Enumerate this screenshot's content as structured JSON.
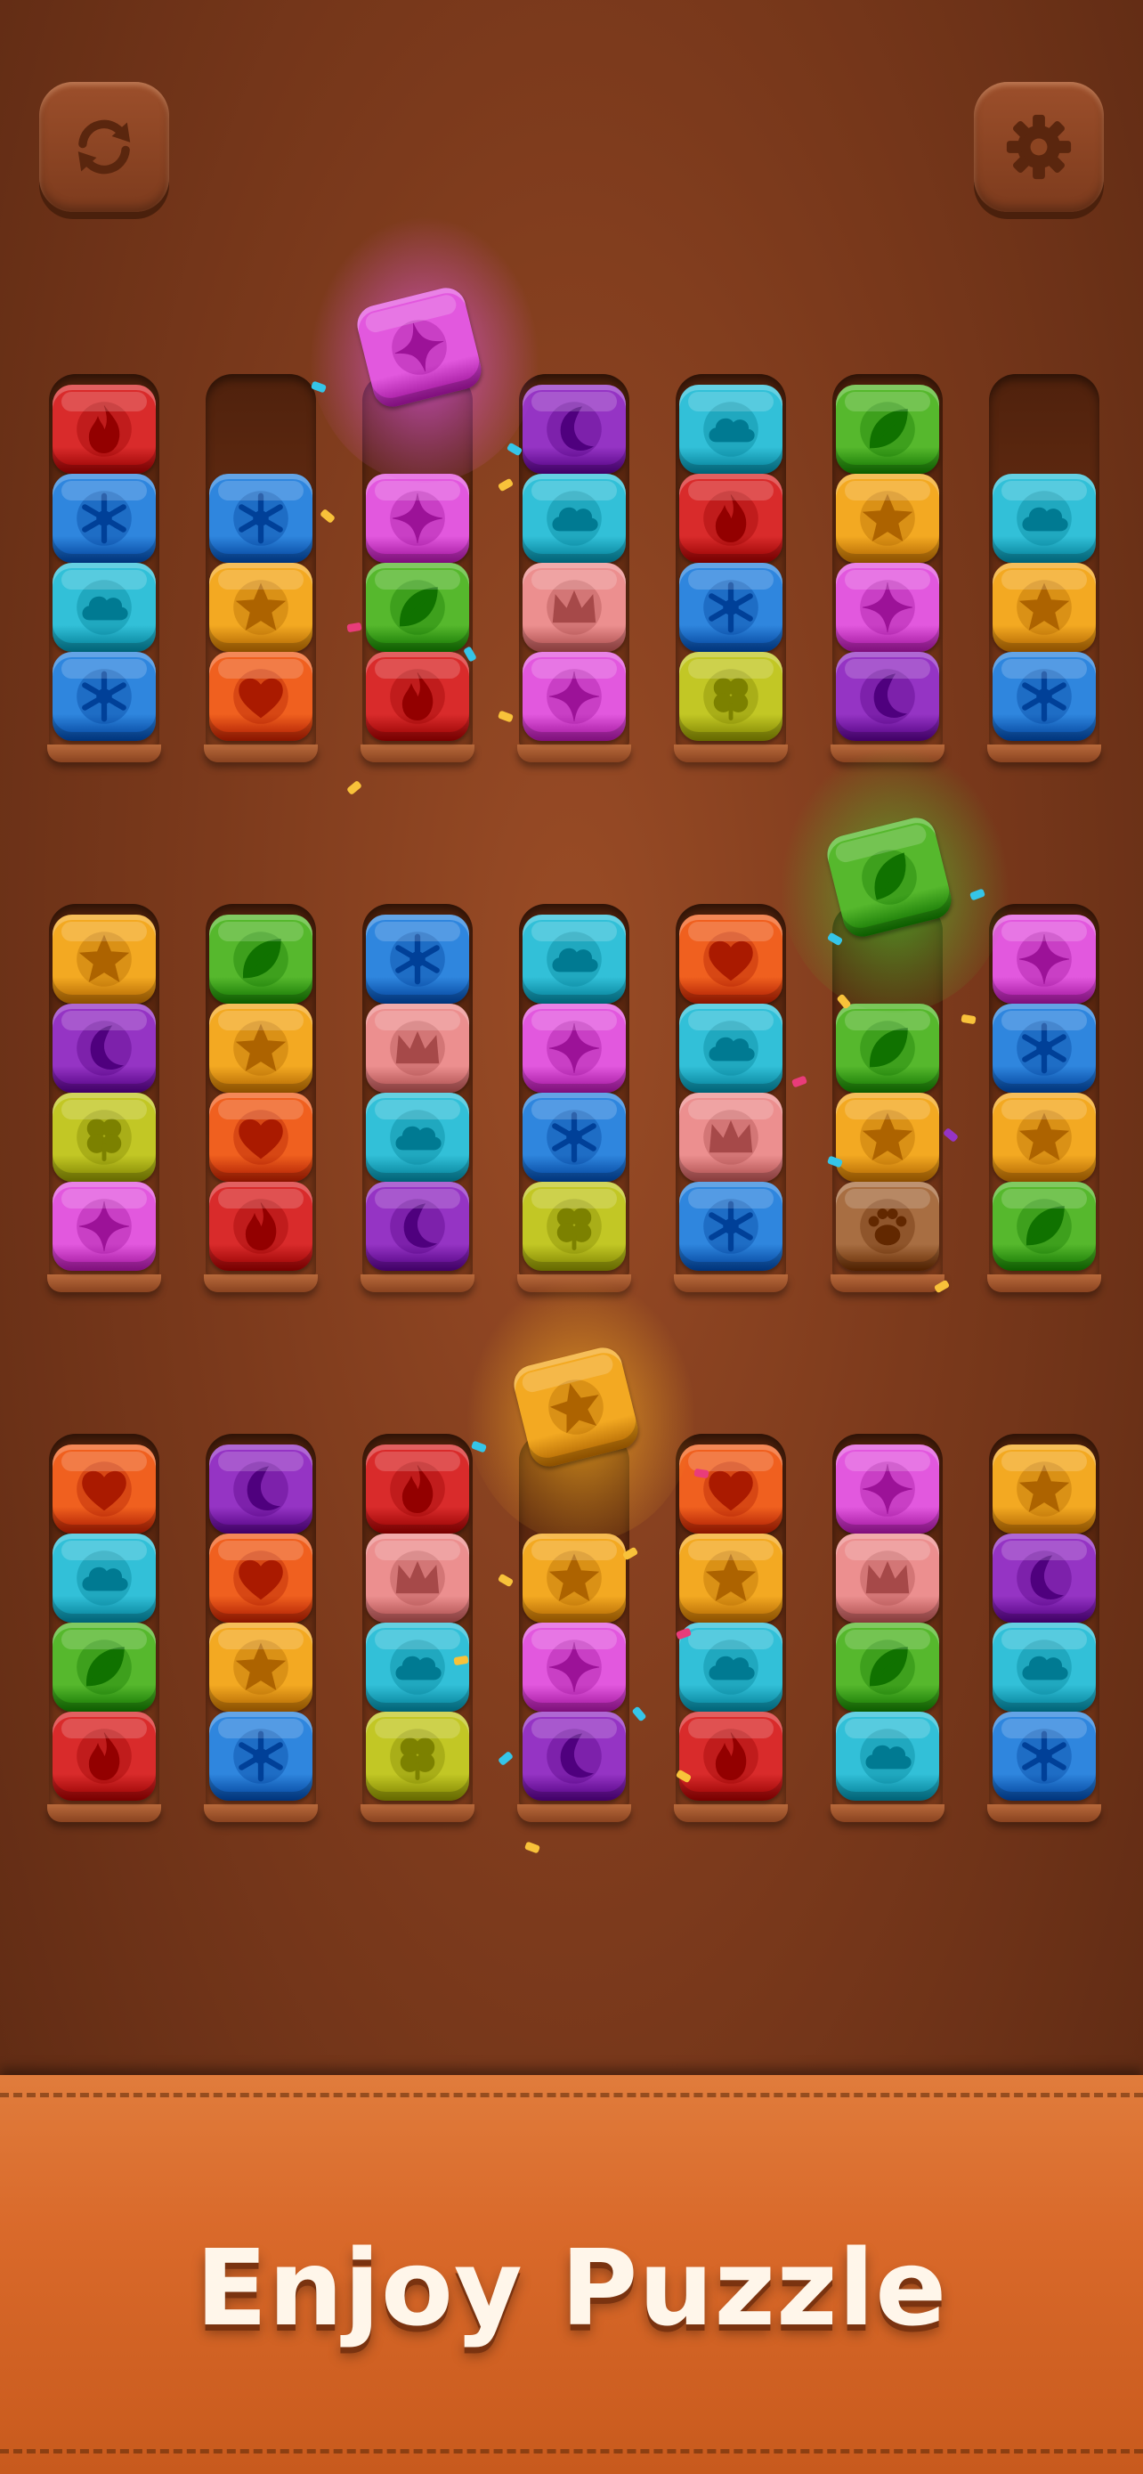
{
  "banner": {
    "title": "Enjoy Puzzle"
  },
  "buttons": {
    "restart_icon": "restart-icon",
    "settings_icon": "gear-icon"
  },
  "colors": {
    "red": "#d92b2b",
    "blue": "#2f86de",
    "cyan": "#32c0d8",
    "yellow": "#f3a922",
    "orange": "#f0601f",
    "green": "#56b82d",
    "purple": "#9534c4",
    "pink": "#e258de",
    "salmon": "#ec8f8f",
    "lime": "#c2c725",
    "brown": "#a86e42"
  },
  "symbols": {
    "red": "flame",
    "blue": "snowflake",
    "cyan": "cloud",
    "yellow": "star",
    "orange": "heart",
    "green": "leaf",
    "purple": "moon",
    "pink": "sparkle",
    "salmon": "crown",
    "lime": "clover",
    "brown": "paw"
  },
  "rows": [
    {
      "tubes": [
        [
          "red",
          "blue",
          "cyan",
          "blue"
        ],
        [
          "blue",
          "yellow",
          "orange"
        ],
        [
          "pink",
          "green",
          "red"
        ],
        [
          "purple",
          "cyan",
          "salmon",
          "pink"
        ],
        [
          "cyan",
          "red",
          "blue",
          "lime"
        ],
        [
          "green",
          "yellow",
          "pink",
          "purple"
        ],
        [
          "cyan",
          "yellow",
          "blue"
        ]
      ],
      "lifted": {
        "tube": 2,
        "color": "pink"
      }
    },
    {
      "tubes": [
        [
          "yellow",
          "purple",
          "lime",
          "pink"
        ],
        [
          "green",
          "yellow",
          "orange",
          "red"
        ],
        [
          "blue",
          "salmon",
          "cyan",
          "purple"
        ],
        [
          "cyan",
          "pink",
          "blue",
          "lime"
        ],
        [
          "orange",
          "cyan",
          "salmon",
          "blue"
        ],
        [
          "green",
          "yellow",
          "brown"
        ],
        [
          "pink",
          "blue",
          "yellow",
          "green"
        ]
      ],
      "lifted": {
        "tube": 5,
        "color": "green"
      }
    },
    {
      "tubes": [
        [
          "orange",
          "cyan",
          "green",
          "red"
        ],
        [
          "purple",
          "orange",
          "yellow",
          "blue"
        ],
        [
          "red",
          "salmon",
          "cyan",
          "lime"
        ],
        [
          "yellow",
          "pink",
          "purple"
        ],
        [
          "orange",
          "yellow",
          "cyan",
          "red"
        ],
        [
          "pink",
          "salmon",
          "green",
          "cyan"
        ],
        [
          "yellow",
          "purple",
          "cyan",
          "blue"
        ]
      ],
      "lifted": {
        "tube": 3,
        "color": "yellow"
      }
    }
  ]
}
